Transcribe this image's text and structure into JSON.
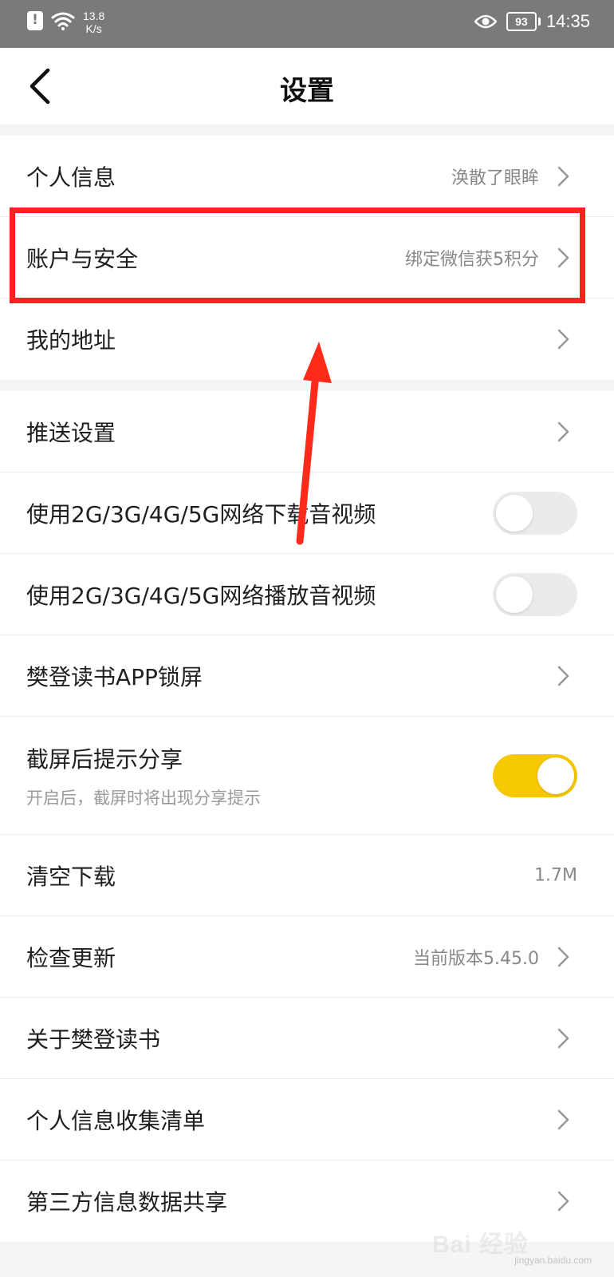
{
  "status_bar": {
    "speed_value": "13.8",
    "speed_unit": "K/s",
    "battery": "93",
    "time": "14:35"
  },
  "header": {
    "title": "设置"
  },
  "group1": [
    {
      "label": "个人信息",
      "value": "涣散了眼眸"
    },
    {
      "label": "账户与安全",
      "value": "绑定微信获5积分"
    },
    {
      "label": "我的地址"
    }
  ],
  "group2": [
    {
      "label": "推送设置"
    },
    {
      "label": "使用2G/3G/4G/5G网络下载音视频",
      "toggle": "off"
    },
    {
      "label": "使用2G/3G/4G/5G网络播放音视频",
      "toggle": "off"
    },
    {
      "label": "樊登读书APP锁屏"
    },
    {
      "label": "截屏后提示分享",
      "sub": "开启后，截屏时将出现分享提示",
      "toggle": "on"
    },
    {
      "label": "清空下载",
      "value": "1.7M"
    },
    {
      "label": "检查更新",
      "value": "当前版本5.45.0"
    },
    {
      "label": "关于樊登读书"
    },
    {
      "label": "个人信息收集清单"
    },
    {
      "label": "第三方信息数据共享"
    }
  ],
  "watermark": {
    "text": "Bai 经验",
    "url": "jingyan.baidu.com"
  },
  "colors": {
    "status_bar_bg": "#7a7a7a",
    "toggle_on": "#f5c800",
    "annotation_red": "#ff2020"
  }
}
